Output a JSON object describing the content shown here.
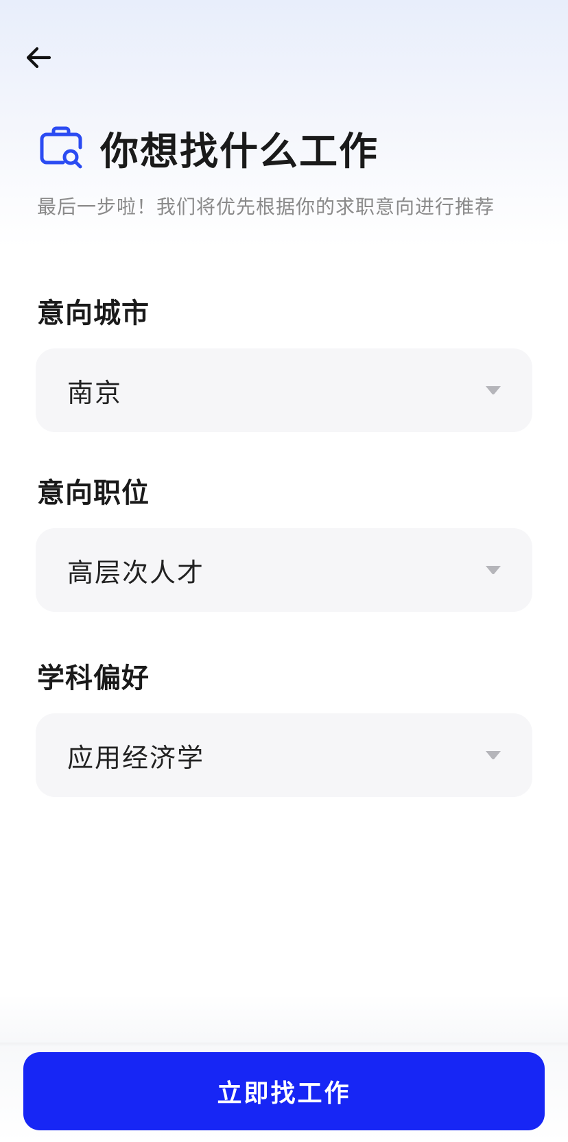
{
  "header": {
    "back_icon": "arrow-left-icon",
    "title_icon": "briefcase-search-icon",
    "title": "你想找什么工作",
    "subtitle": "最后一步啦！我们将优先根据你的求职意向进行推荐"
  },
  "form": {
    "city": {
      "label": "意向城市",
      "value": "南京"
    },
    "position": {
      "label": "意向职位",
      "value": "高层次人才"
    },
    "subject": {
      "label": "学科偏好",
      "value": "应用经济学"
    }
  },
  "footer": {
    "submit_label": "立即找工作"
  },
  "colors": {
    "accent": "#1726F5",
    "icon_blue": "#2B4BF2",
    "field_bg": "#F6F6F8",
    "chevron": "#B5B5BA"
  }
}
